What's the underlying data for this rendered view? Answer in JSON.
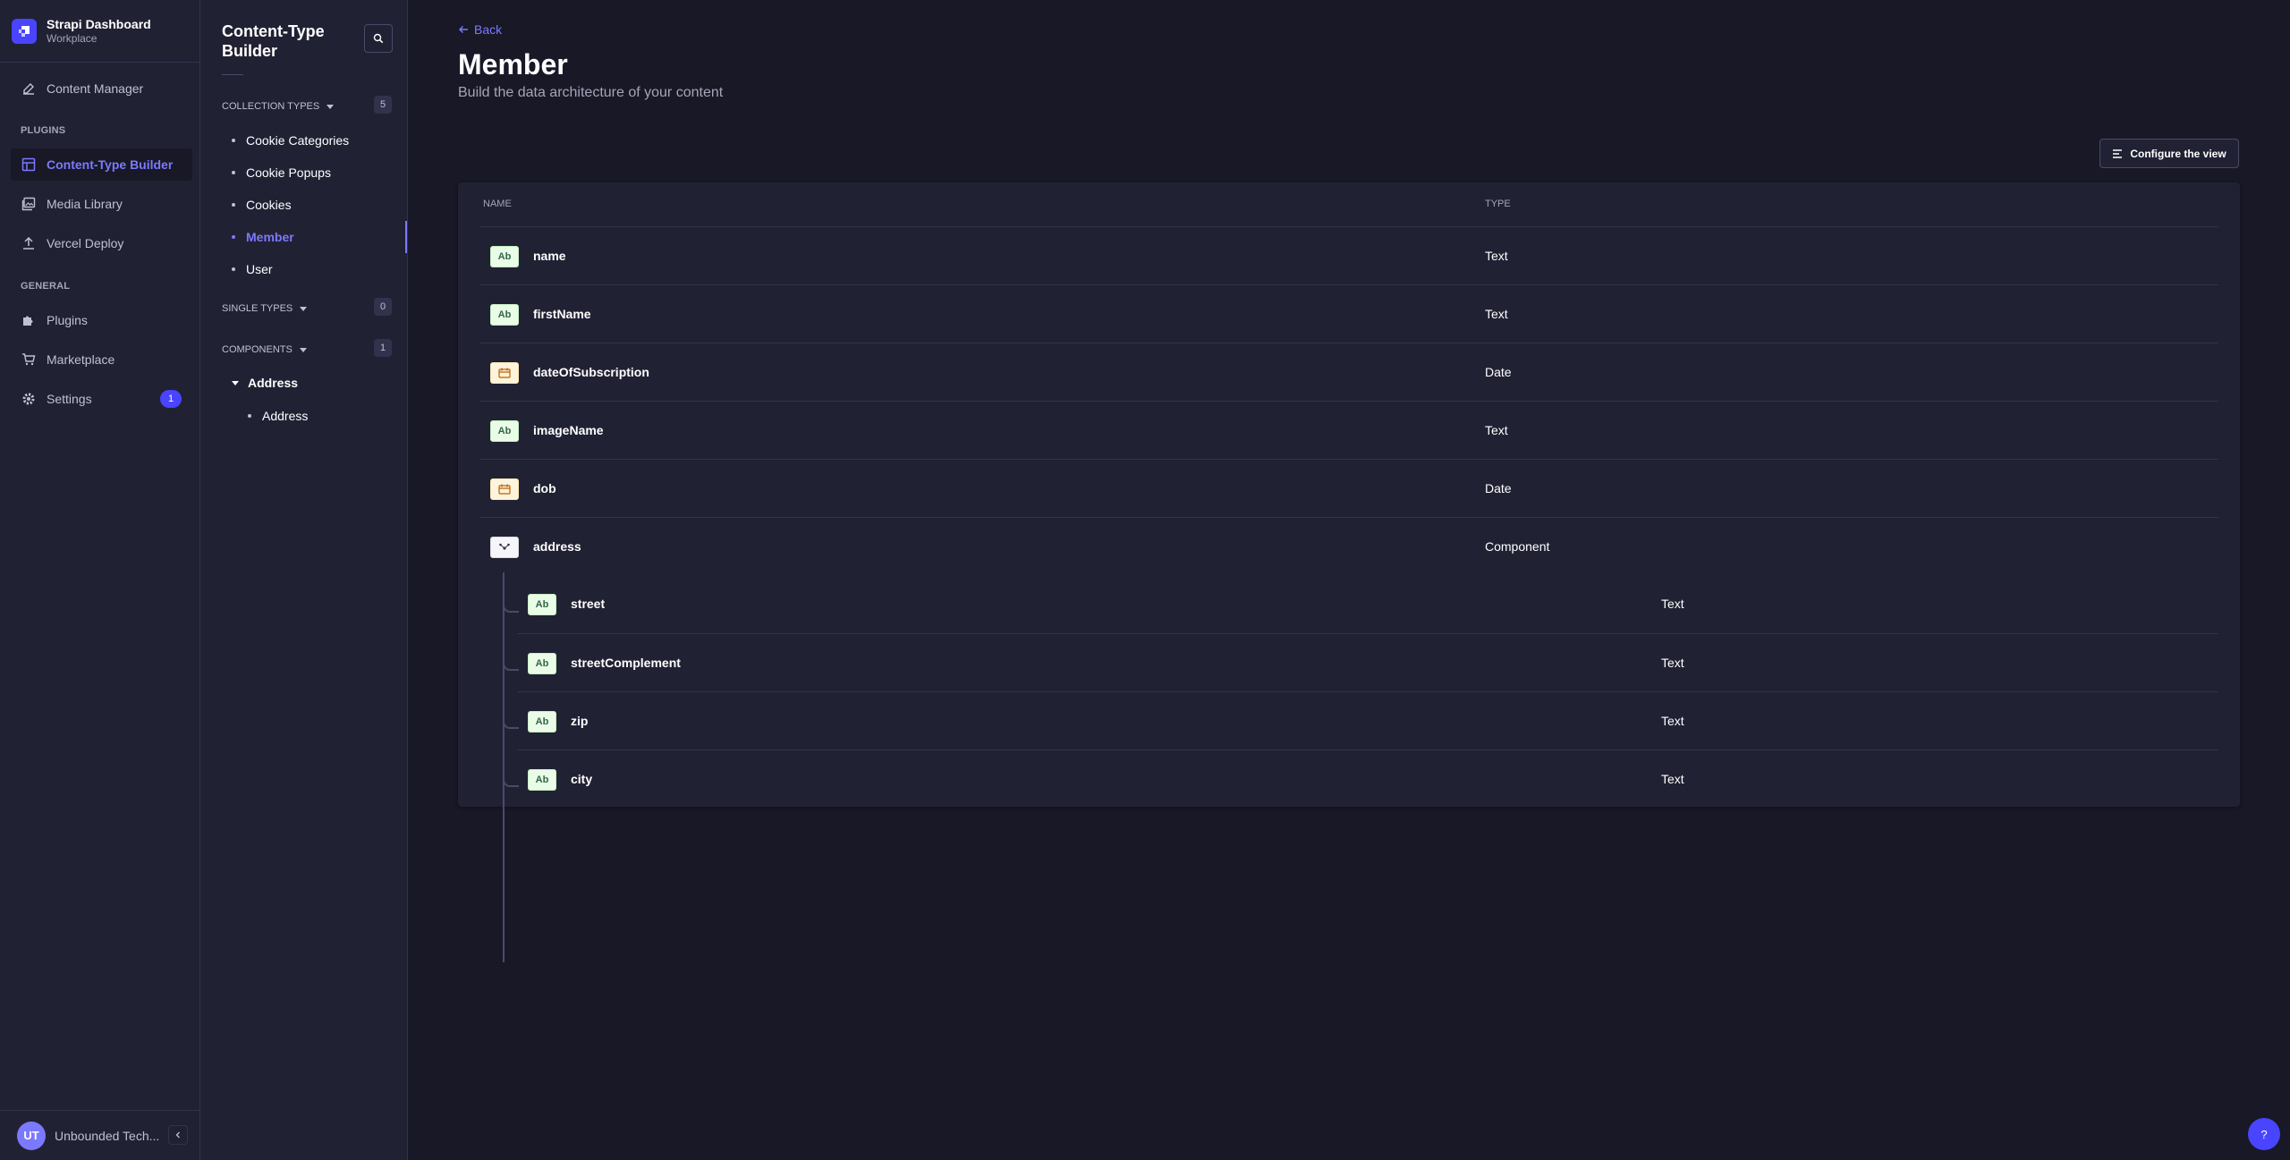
{
  "brand": {
    "title": "Strapi Dashboard",
    "subtitle": "Workplace"
  },
  "mainnav": {
    "content_manager": "Content Manager",
    "plugins_section": "PLUGINS",
    "content_type_builder": "Content-Type Builder",
    "media_library": "Media Library",
    "vercel_deploy": "Vercel Deploy",
    "general_section": "GENERAL",
    "plugins": "Plugins",
    "marketplace": "Marketplace",
    "settings": "Settings",
    "settings_badge": "1"
  },
  "user": {
    "initials": "UT",
    "name": "Unbounded Tech..."
  },
  "subnav": {
    "title": "Content-Type Builder",
    "collection_types": {
      "label": "COLLECTION TYPES",
      "count": "5",
      "items": [
        "Cookie Categories",
        "Cookie Popups",
        "Cookies",
        "Member",
        "User"
      ]
    },
    "single_types": {
      "label": "SINGLE TYPES",
      "count": "0"
    },
    "components": {
      "label": "COMPONENTS",
      "count": "1",
      "group": "Address",
      "items": [
        "Address"
      ]
    }
  },
  "main": {
    "back": "Back",
    "title": "Member",
    "subtitle": "Build the data architecture of your content",
    "configure": "Configure the view",
    "col_name": "NAME",
    "col_type": "TYPE",
    "fields": [
      {
        "icon": "Ab",
        "name": "name",
        "type": "Text"
      },
      {
        "icon": "Ab",
        "name": "firstName",
        "type": "Text"
      },
      {
        "icon": "date",
        "name": "dateOfSubscription",
        "type": "Date"
      },
      {
        "icon": "Ab",
        "name": "imageName",
        "type": "Text"
      },
      {
        "icon": "date",
        "name": "dob",
        "type": "Date"
      },
      {
        "icon": "component",
        "name": "address",
        "type": "Component"
      }
    ],
    "sub_fields": [
      {
        "icon": "Ab",
        "name": "street",
        "type": "Text"
      },
      {
        "icon": "Ab",
        "name": "streetComplement",
        "type": "Text"
      },
      {
        "icon": "Ab",
        "name": "zip",
        "type": "Text"
      },
      {
        "icon": "Ab",
        "name": "city",
        "type": "Text"
      }
    ]
  },
  "help": "?"
}
